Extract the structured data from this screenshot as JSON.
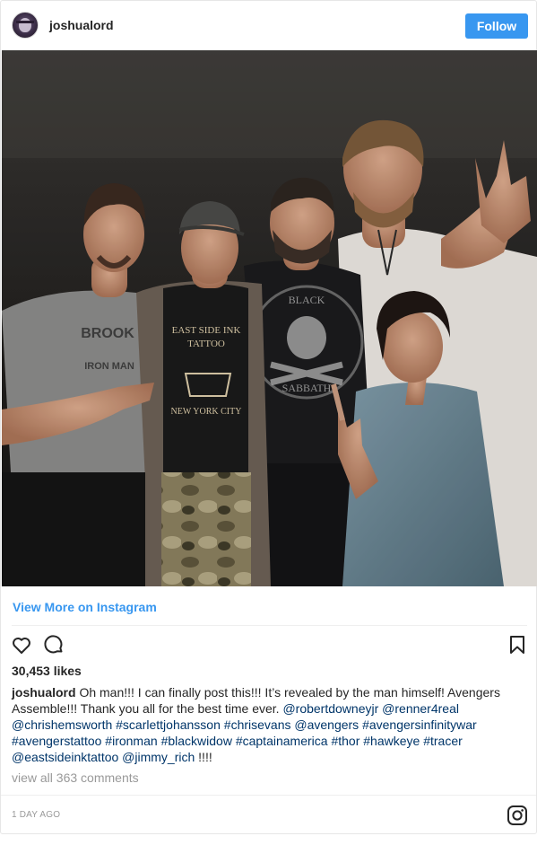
{
  "header": {
    "username": "joshualord",
    "follow_label": "Follow"
  },
  "photo": {
    "shirt_text_1": "EAST SIDE INK",
    "shirt_text_2": "TATTOO",
    "shirt_text_3": "NEW YORK CITY",
    "shirt_text_4": "BLACK",
    "shirt_text_5": "SABBATH",
    "shirt_text_6": "BROOK",
    "shirt_text_7": "IRON MAN"
  },
  "view_more_label": "View More on Instagram",
  "actions": {
    "like_icon": "heart-icon",
    "comment_icon": "comment-icon",
    "save_icon": "bookmark-icon"
  },
  "likes_text": "30,453 likes",
  "caption": {
    "username": "joshualord",
    "text_1": " Oh man!!! I can finally post this!!! It’s revealed by the man himself! Avengers Assemble!!! Thank you all for the best time ever. ",
    "tags": [
      "@robertdowneyjr",
      "@renner4real",
      "@chrishemsworth",
      "#scarlettjohansson",
      "#chrisevans",
      "@avengers",
      "#avengersinfinitywar",
      "#avengerstattoo",
      "#ironman",
      "#blackwidow",
      "#captainamerica",
      "#thor",
      "#hawkeye",
      "#tracer",
      "@eastsideinktattoo",
      "@jimmy_rich"
    ],
    "text_end": " !!!!"
  },
  "view_comments_label": "view all 363 comments",
  "timestamp": "1 DAY AGO",
  "colors": {
    "accent": "#3897f0",
    "link": "#003569",
    "muted": "#999999"
  }
}
